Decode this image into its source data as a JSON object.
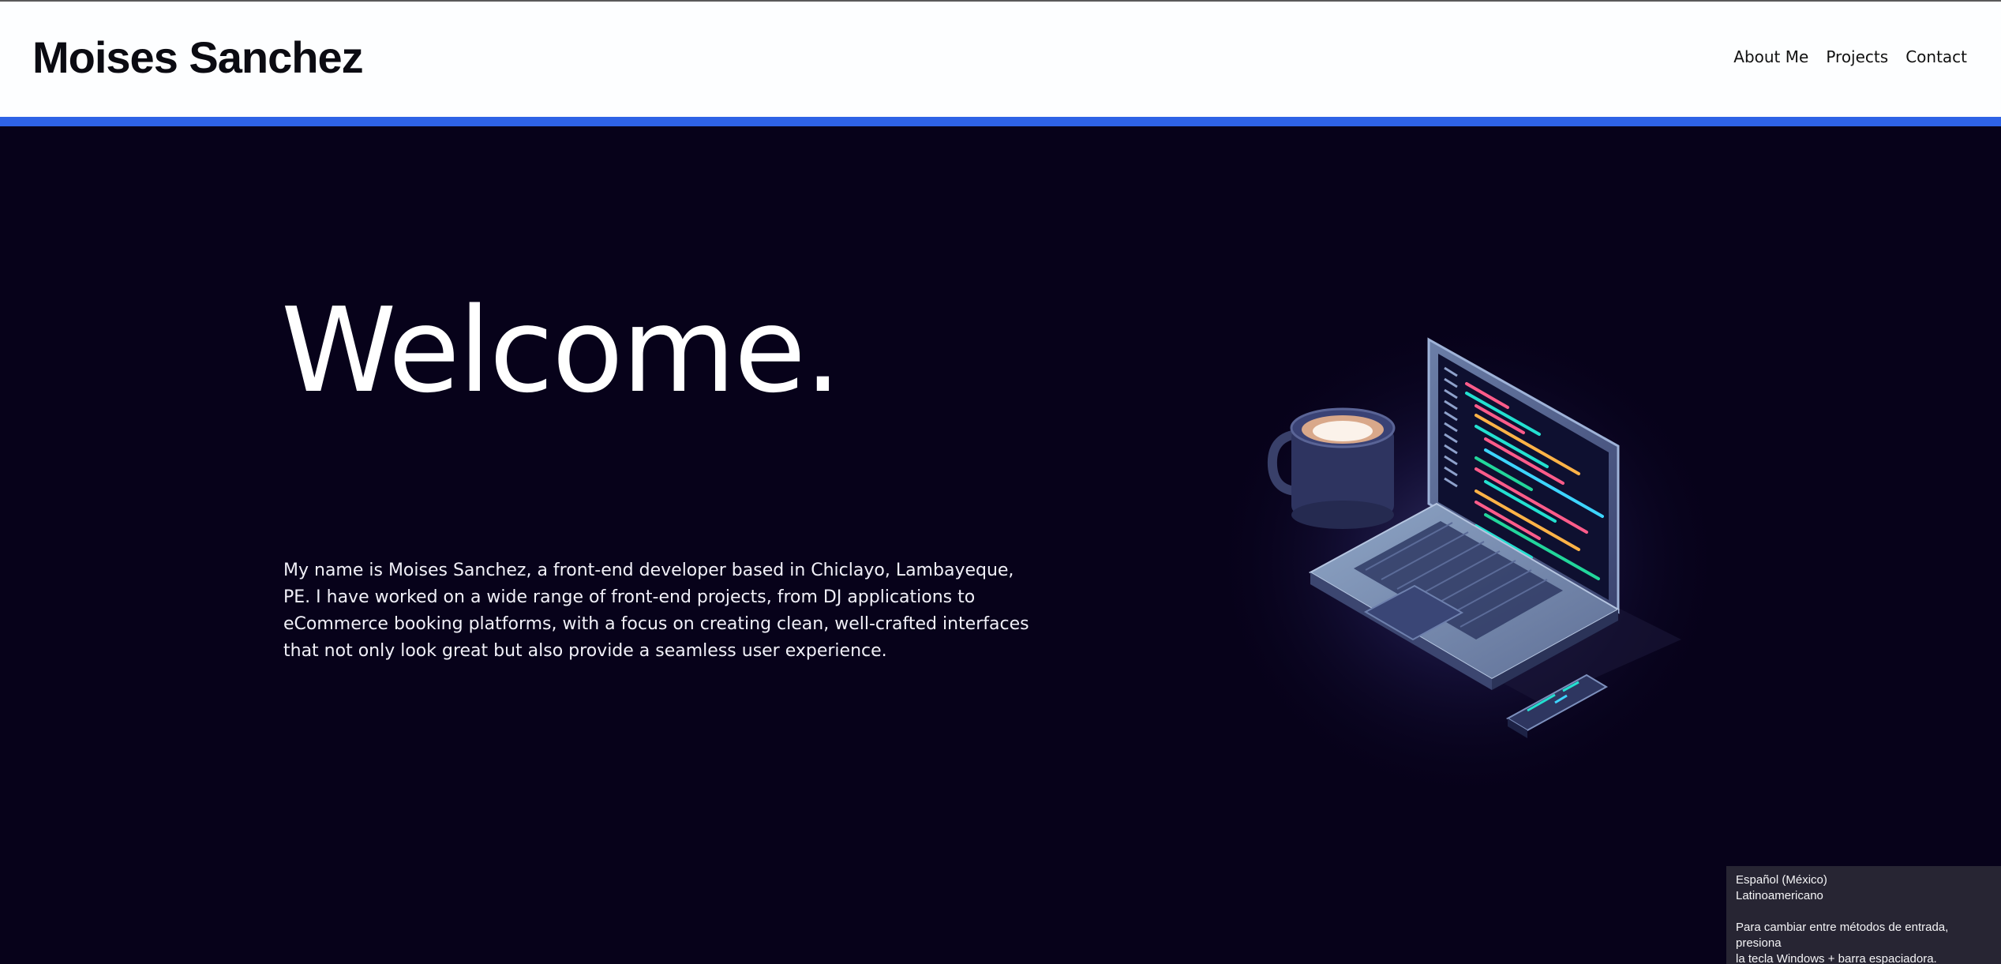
{
  "header": {
    "logo": "Moises Sanchez",
    "nav": [
      {
        "label": "About Me"
      },
      {
        "label": "Projects"
      },
      {
        "label": "Contact"
      }
    ]
  },
  "hero": {
    "title": "Welcome.",
    "intro": "My name is Moises Sanchez, a front-end developer based in Chiclayo, Lambayeque, PE. I have worked on a wide range of front-end projects, from DJ applications to eCommerce booking platforms, with a focus on creating clean, well-crafted interfaces that not only look great but also provide a seamless user experience.",
    "illustration": "laptop-coffee-phone-illustration"
  },
  "ime_tooltip": {
    "line1": "Español (México)",
    "line2": "Latinoamericano",
    "line3": "Para cambiar entre métodos de entrada, presiona",
    "line4": "la tecla Windows + barra espaciadora."
  },
  "colors": {
    "header_bg": "#fdfeff",
    "accent": "#2e63e6",
    "hero_bg": "#07021a",
    "text_light": "#ffffff"
  }
}
